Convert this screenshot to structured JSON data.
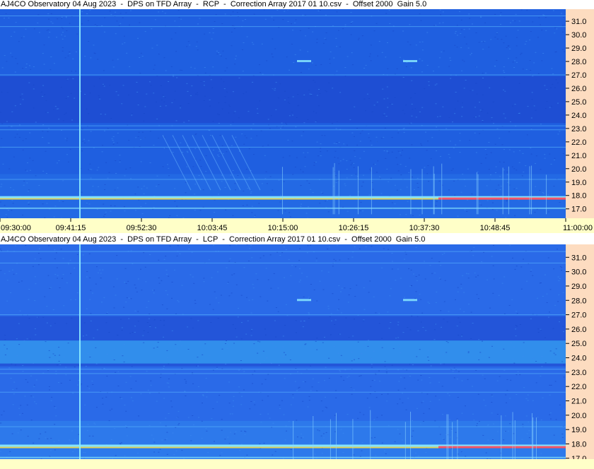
{
  "chart_data": [
    {
      "type": "heatmap",
      "title": "AJ4CO Observatory 04 Aug 2023  -  DPS on TFD Array  -  RCP  -  Correction Array 2017 01 10.csv  -  Offset 2000  Gain 5.0",
      "xlabel": "",
      "ylabel": "",
      "x_tick_labels": [
        "09:30:00",
        "09:41:15",
        "09:52:30",
        "10:03:45",
        "10:15:00",
        "10:26:15",
        "10:37:30",
        "10:48:45",
        "11:00:00"
      ],
      "y_tick_labels": [
        "31.0",
        "30.0",
        "29.0",
        "28.0",
        "27.0",
        "26.0",
        "25.0",
        "24.0",
        "23.0",
        "22.0",
        "21.0",
        "20.0",
        "19.0",
        "18.0",
        "17.0"
      ],
      "xlim": [
        "09:30:00",
        "11:00:00"
      ],
      "ylim": [
        16.3,
        31.9
      ],
      "colors": {
        "background": "#1f5fe0",
        "band_low": "#1e3fc8",
        "band_high": "#2e86ee",
        "line": "#8ff0ff",
        "hot": "#ff4060",
        "warm": "#ffe040"
      }
    },
    {
      "type": "heatmap",
      "title": "AJ4CO Observatory 04 Aug 2023  -  DPS on TFD Array  -  LCP  -  Correction Array 2017 01 10.csv  -  Offset 2000  Gain 5.0",
      "xlabel": "",
      "ylabel": "",
      "x_tick_labels": [],
      "y_tick_labels": [
        "31.0",
        "30.0",
        "29.0",
        "28.0",
        "27.0",
        "26.0",
        "25.0",
        "24.0",
        "23.0",
        "22.0",
        "21.0",
        "20.0",
        "19.0",
        "18.0",
        "17.0"
      ],
      "ylim": [
        16.3,
        31.9
      ],
      "colors": {
        "background": "#2a6ae8",
        "band_low": "#1e44cc",
        "band_high": "#38a6f4",
        "line": "#8ff0ff",
        "hot": "#ff4060",
        "warm": "#ffe040"
      }
    }
  ]
}
